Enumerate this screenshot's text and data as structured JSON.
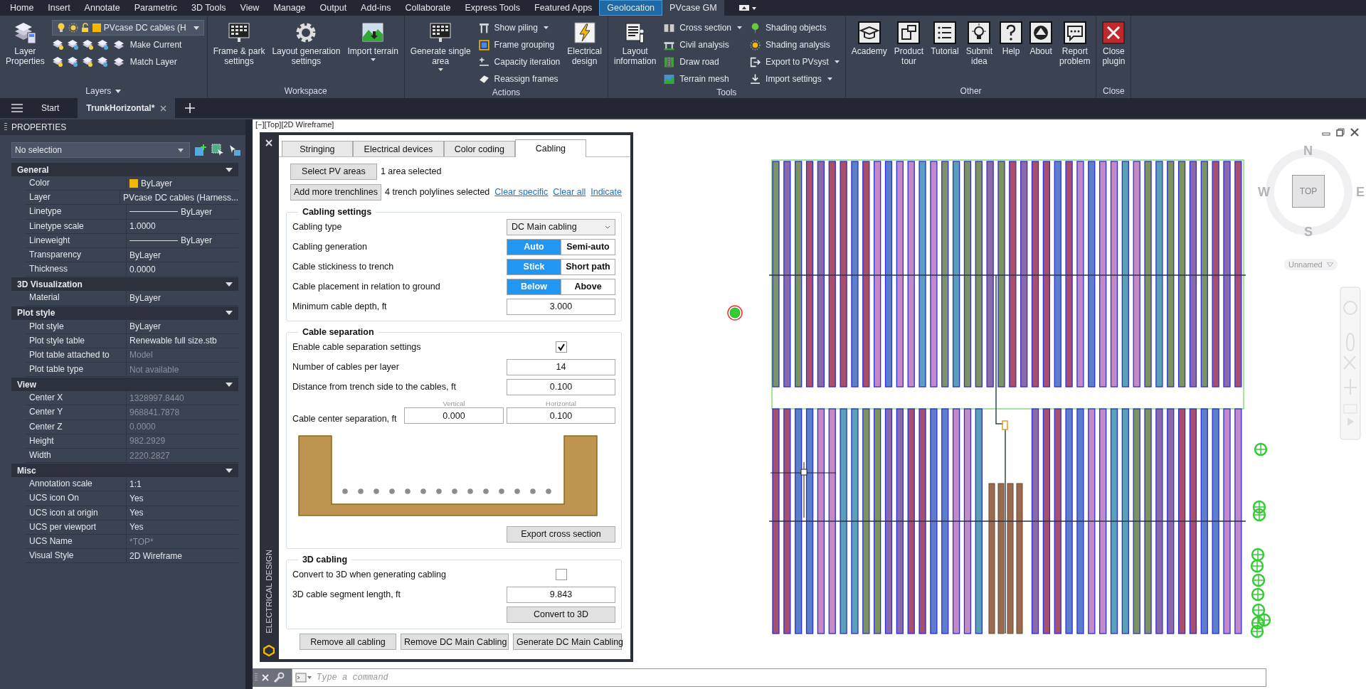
{
  "menu_tabs": [
    {
      "label": "Home",
      "selected": false,
      "kind": "normal"
    },
    {
      "label": "Insert",
      "selected": false,
      "kind": "normal"
    },
    {
      "label": "Annotate",
      "selected": false,
      "kind": "normal"
    },
    {
      "label": "Parametric",
      "selected": false,
      "kind": "normal"
    },
    {
      "label": "3D Tools",
      "selected": false,
      "kind": "normal"
    },
    {
      "label": "View",
      "selected": false,
      "kind": "normal"
    },
    {
      "label": "Manage",
      "selected": false,
      "kind": "normal"
    },
    {
      "label": "Output",
      "selected": false,
      "kind": "normal"
    },
    {
      "label": "Add-ins",
      "selected": false,
      "kind": "normal"
    },
    {
      "label": "Collaborate",
      "selected": false,
      "kind": "normal"
    },
    {
      "label": "Express Tools",
      "selected": false,
      "kind": "normal"
    },
    {
      "label": "Featured Apps",
      "selected": false,
      "kind": "normal"
    },
    {
      "label": "Geolocation",
      "selected": false,
      "kind": "contextual"
    },
    {
      "label": "PVcase GM",
      "selected": true,
      "kind": "normal"
    }
  ],
  "ribbon_panels": [
    {
      "title": "Layers",
      "has_menu": true,
      "groups": [
        {
          "kind": "large",
          "label_lines": [
            "Layer",
            "Properties"
          ],
          "dropdown": false
        },
        {
          "kind": "layer",
          "layer_name": "PVcase DC cables (H",
          "actions": [
            "Make Current",
            "Match Layer"
          ]
        }
      ]
    },
    {
      "title": "Workspace",
      "has_menu": false,
      "groups": [
        {
          "kind": "large",
          "label_lines": [
            "Frame & park",
            "settings"
          ],
          "dropdown": false
        },
        {
          "kind": "large",
          "label_lines": [
            "Layout generation",
            "settings"
          ],
          "dropdown": false
        },
        {
          "kind": "large",
          "label_lines": [
            "Import terrain"
          ],
          "dropdown": true
        }
      ]
    },
    {
      "title": "Actions",
      "has_menu": false,
      "groups": [
        {
          "kind": "large",
          "label_lines": [
            "Generate single",
            "area"
          ],
          "dropdown": true
        },
        {
          "kind": "small",
          "items": [
            {
              "label": "Show piling",
              "dropdown": true
            },
            {
              "label": "Frame grouping",
              "dropdown": false
            },
            {
              "label": "Capacity iteration",
              "dropdown": false
            },
            {
              "label": "Reassign frames",
              "dropdown": false
            }
          ]
        },
        {
          "kind": "large",
          "label_lines": [
            "Electrical",
            "design"
          ],
          "dropdown": false
        }
      ]
    },
    {
      "title": "Tools",
      "has_menu": false,
      "groups": [
        {
          "kind": "large",
          "label_lines": [
            "Layout",
            "information"
          ],
          "dropdown": false
        },
        {
          "kind": "small",
          "items": [
            {
              "label": "Cross section",
              "dropdown": true
            },
            {
              "label": "Civil analysis",
              "dropdown": false
            },
            {
              "label": "Draw road",
              "dropdown": false
            },
            {
              "label": "Terrain mesh",
              "dropdown": false
            }
          ]
        },
        {
          "kind": "small",
          "items": [
            {
              "label": "Shading objects",
              "dropdown": false
            },
            {
              "label": "Shading analysis",
              "dropdown": false
            },
            {
              "label": "Export to PVsyst",
              "dropdown": true
            },
            {
              "label": "Import settings",
              "dropdown": true
            }
          ]
        }
      ]
    },
    {
      "title": "Other",
      "has_menu": false,
      "groups": [
        {
          "kind": "large",
          "label_lines": [
            "Academy"
          ],
          "dropdown": false
        },
        {
          "kind": "large",
          "label_lines": [
            "Product",
            "tour"
          ],
          "dropdown": false
        },
        {
          "kind": "large",
          "label_lines": [
            "Tutorial"
          ],
          "dropdown": false
        },
        {
          "kind": "large",
          "label_lines": [
            "Submit",
            "idea"
          ],
          "dropdown": false
        },
        {
          "kind": "large",
          "label_lines": [
            "Help"
          ],
          "dropdown": false
        },
        {
          "kind": "large",
          "label_lines": [
            "About"
          ],
          "dropdown": false
        },
        {
          "kind": "large",
          "label_lines": [
            "Report",
            "problem"
          ],
          "dropdown": false
        }
      ]
    },
    {
      "title": "Close",
      "has_menu": false,
      "groups": [
        {
          "kind": "large",
          "label_lines": [
            "Close",
            "plugin"
          ],
          "dropdown": false
        }
      ]
    }
  ],
  "doc_tabs": [
    {
      "label": "Start",
      "selected": false,
      "closable": false
    },
    {
      "label": "TrunkHorizontal*",
      "selected": true,
      "closable": true
    }
  ],
  "properties": {
    "title": "PROPERTIES",
    "selection": "No selection",
    "sections": [
      {
        "title": "General",
        "expanded": true,
        "rows": [
          {
            "label": "Color",
            "value": "ByLayer",
            "kind": "color",
            "disabled": false
          },
          {
            "label": "Layer",
            "value": "PVcase  DC  cables  (Harness...",
            "kind": "text",
            "disabled": false
          },
          {
            "label": "Linetype",
            "value": "ByLayer",
            "kind": "line",
            "disabled": false
          },
          {
            "label": "Linetype scale",
            "value": "1.0000",
            "kind": "text",
            "disabled": false
          },
          {
            "label": "Lineweight",
            "value": "ByLayer",
            "kind": "line",
            "disabled": false
          },
          {
            "label": "Transparency",
            "value": "ByLayer",
            "kind": "text",
            "disabled": false
          },
          {
            "label": "Thickness",
            "value": "0.0000",
            "kind": "text",
            "disabled": false
          }
        ]
      },
      {
        "title": "3D Visualization",
        "expanded": true,
        "rows": [
          {
            "label": "Material",
            "value": "ByLayer",
            "kind": "text",
            "disabled": false
          }
        ]
      },
      {
        "title": "Plot style",
        "expanded": true,
        "rows": [
          {
            "label": "Plot style",
            "value": "ByLayer",
            "kind": "text",
            "disabled": false
          },
          {
            "label": "Plot style table",
            "value": "Renewable full size.stb",
            "kind": "text",
            "disabled": false
          },
          {
            "label": "Plot table attached to",
            "value": "Model",
            "kind": "text",
            "disabled": true
          },
          {
            "label": "Plot table type",
            "value": "Not available",
            "kind": "text",
            "disabled": true
          }
        ]
      },
      {
        "title": "View",
        "expanded": true,
        "rows": [
          {
            "label": "Center X",
            "value": "1328997.8440",
            "kind": "text",
            "disabled": true
          },
          {
            "label": "Center Y",
            "value": "968841.7878",
            "kind": "text",
            "disabled": true
          },
          {
            "label": "Center Z",
            "value": "0.0000",
            "kind": "text",
            "disabled": true
          },
          {
            "label": "Height",
            "value": "982.2929",
            "kind": "text",
            "disabled": true
          },
          {
            "label": "Width",
            "value": "2220.2827",
            "kind": "text",
            "disabled": true
          }
        ]
      },
      {
        "title": "Misc",
        "expanded": true,
        "rows": [
          {
            "label": "Annotation scale",
            "value": "1:1",
            "kind": "text",
            "disabled": false
          },
          {
            "label": "UCS icon On",
            "value": "Yes",
            "kind": "text",
            "disabled": false
          },
          {
            "label": "UCS icon at origin",
            "value": "Yes",
            "kind": "text",
            "disabled": false
          },
          {
            "label": "UCS per viewport",
            "value": "Yes",
            "kind": "text",
            "disabled": false
          },
          {
            "label": "UCS Name",
            "value": "*TOP*",
            "kind": "text",
            "disabled": true
          },
          {
            "label": "Visual Style",
            "value": "2D Wireframe",
            "kind": "text",
            "disabled": false
          }
        ]
      }
    ]
  },
  "viewport": {
    "label": "[−][Top][2D Wireframe]",
    "viewcube": {
      "north": "N",
      "south": "S",
      "east": "E",
      "west": "W",
      "face": "TOP",
      "ucs_menu": "Unnamed"
    }
  },
  "dialog": {
    "side_title": "ELECTRICAL DESIGN",
    "tabs": [
      {
        "label": "Stringing",
        "selected": false
      },
      {
        "label": "Electrical devices",
        "selected": false
      },
      {
        "label": "Color coding",
        "selected": false
      },
      {
        "label": "Cabling",
        "selected": true
      }
    ],
    "pick_rows": [
      {
        "button": "Select PV areas",
        "status": "1 area selected",
        "links": []
      },
      {
        "button": "Add more trenchlines",
        "status": "4 trench polylines selected",
        "links": [
          "Clear specific",
          "Clear all",
          "Indicate"
        ]
      }
    ],
    "sections": [
      {
        "title": "Cabling settings",
        "rows": [
          {
            "kind": "select",
            "label": "Cabling type",
            "value": "DC Main cabling"
          },
          {
            "kind": "toggle",
            "label": "Cabling generation",
            "options": [
              {
                "label": "Auto",
                "selected": true
              },
              {
                "label": "Semi-auto",
                "selected": false
              }
            ]
          },
          {
            "kind": "toggle",
            "label": "Cable stickiness to trench",
            "options": [
              {
                "label": "Stick",
                "selected": true
              },
              {
                "label": "Short path",
                "selected": false
              }
            ]
          },
          {
            "kind": "toggle",
            "label": "Cable placement in relation to ground",
            "options": [
              {
                "label": "Below",
                "selected": true
              },
              {
                "label": "Above",
                "selected": false
              }
            ]
          },
          {
            "kind": "input",
            "label": "Minimum cable depth, ft",
            "value": "3.000"
          }
        ]
      },
      {
        "title": "Cable separation",
        "rows": [
          {
            "kind": "checkbox",
            "label": "Enable cable separation settings",
            "checked": true
          },
          {
            "kind": "input",
            "label": "Number of cables per layer",
            "value": "14"
          },
          {
            "kind": "input",
            "label": "Distance from trench side to the cables, ft",
            "value": "0.100"
          },
          {
            "kind": "pair",
            "label": "Cable center separation, ft",
            "fields": [
              {
                "caption": "Vertical",
                "value": "0.000"
              },
              {
                "caption": "Horizontal",
                "value": "0.100"
              }
            ]
          },
          {
            "kind": "trench"
          },
          {
            "kind": "button",
            "label": "Export cross section"
          }
        ]
      },
      {
        "title": "3D cabling",
        "rows": [
          {
            "kind": "checkbox",
            "label": "Convert to 3D when generating cabling",
            "checked": false
          },
          {
            "kind": "input",
            "label": "3D cable segment length, ft",
            "value": "9.843"
          },
          {
            "kind": "button",
            "label": "Convert to 3D"
          }
        ]
      }
    ],
    "buttons": [
      "Remove all cabling",
      "Remove DC Main Cabling",
      "Generate DC Main Cabling"
    ]
  },
  "command_line": {
    "placeholder": "Type a command"
  }
}
